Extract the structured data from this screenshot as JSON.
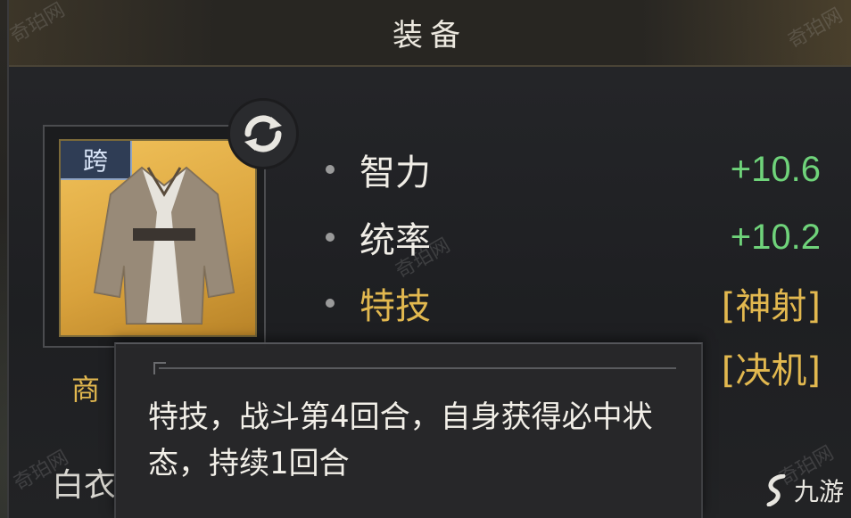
{
  "header": {
    "title": "装备"
  },
  "item": {
    "cross_tag": "跨",
    "name_prefix": "商",
    "name_partial": "白衣"
  },
  "stats": [
    {
      "label": "智力",
      "value": "+10.6"
    },
    {
      "label": "统率",
      "value": "+10.2"
    },
    {
      "label": "特技",
      "value": "[神射]"
    },
    {
      "value": "[决机]"
    }
  ],
  "tooltip": {
    "text": "特技，战斗第4回合，自身获得必中状态，持续1回合"
  },
  "watermark": {
    "text": "奇珀网"
  },
  "logo": {
    "text": "九游"
  },
  "colors": {
    "green_value": "#6fd37a",
    "gold": "#e2b84f",
    "tag_bg": "#2f3d55"
  }
}
